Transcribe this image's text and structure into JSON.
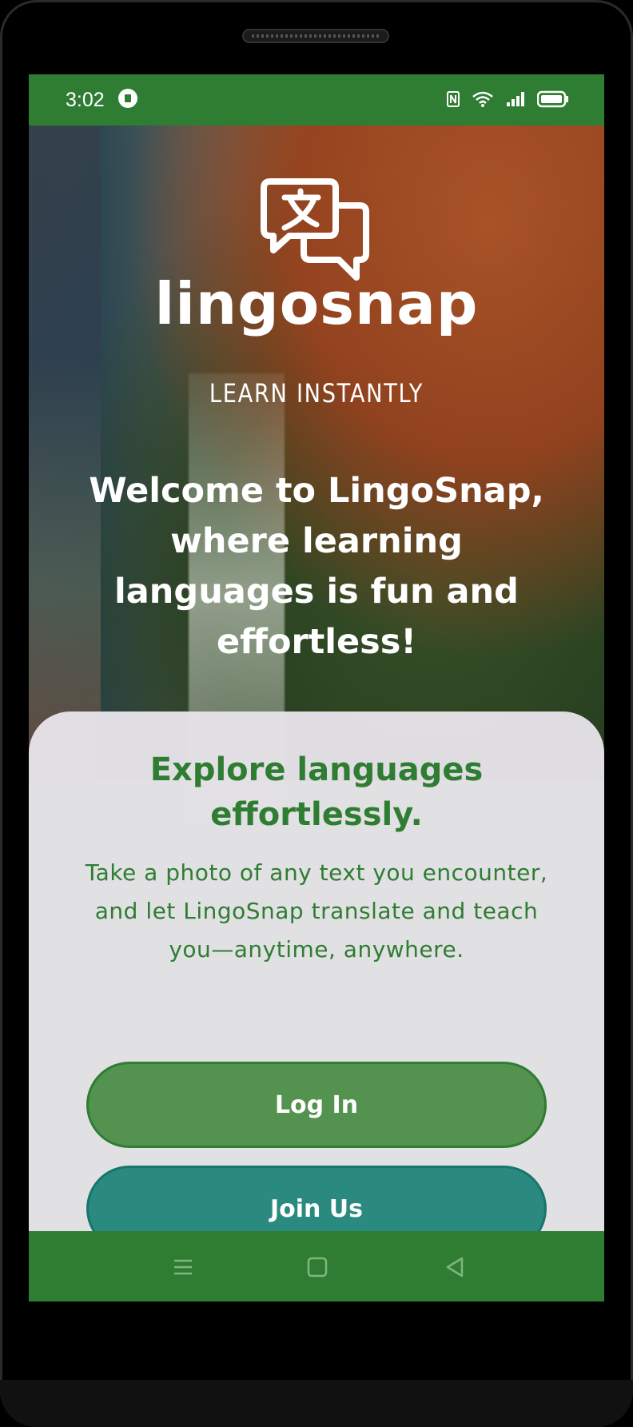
{
  "status_bar": {
    "time": "3:02",
    "icons": [
      "lock-icon",
      "nfc-icon",
      "wifi-icon",
      "signal-icon",
      "battery-icon"
    ]
  },
  "hero": {
    "logo_icon": "speech-bubble-translate-icon",
    "brand_name": "lingosnap",
    "tagline": "LEARN INSTANTLY",
    "welcome": "Welcome to LingoSnap, where learning languages is fun and effortless!"
  },
  "card": {
    "title": "Explore languages effortlessly.",
    "description": "Take a photo of any text you encounter, and let LingoSnap translate and teach you—anytime, anywhere.",
    "login_label": "Log In",
    "join_label": "Join Us"
  },
  "nav_bar": {
    "icons": [
      "menu-icon",
      "home-icon",
      "back-icon"
    ]
  },
  "colors": {
    "primary_green": "#2f7d32",
    "login_button": "#54924f",
    "join_button": "#2a8a80",
    "card_background": "#e8e4ea",
    "text_white": "#ffffff"
  }
}
